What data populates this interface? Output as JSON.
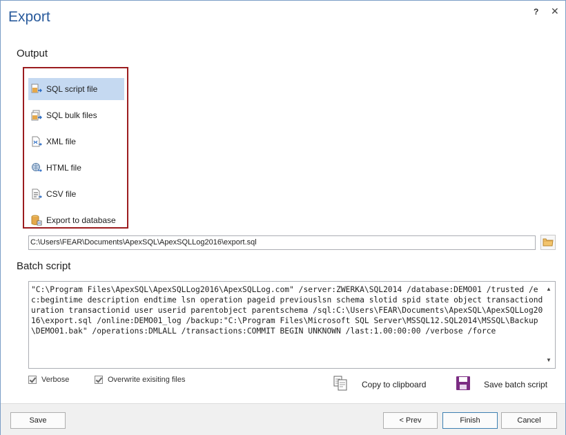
{
  "window": {
    "title": "Export",
    "help_label": "?",
    "close_label": "✕"
  },
  "output": {
    "section_label": "Output",
    "items": [
      {
        "label": "SQL script file",
        "icon": "sql-script-file-icon",
        "selected": true
      },
      {
        "label": "SQL bulk files",
        "icon": "sql-bulk-files-icon",
        "selected": false
      },
      {
        "label": "XML file",
        "icon": "xml-file-icon",
        "selected": false
      },
      {
        "label": "HTML file",
        "icon": "html-file-icon",
        "selected": false
      },
      {
        "label": "CSV file",
        "icon": "csv-file-icon",
        "selected": false
      },
      {
        "label": "Export to database",
        "icon": "export-to-database-icon",
        "selected": false
      }
    ],
    "path_value": "C:\\Users\\FEAR\\Documents\\ApexSQL\\ApexSQLLog2016\\export.sql"
  },
  "batch": {
    "section_label": "Batch script",
    "script_text": "\"C:\\Program Files\\ApexSQL\\ApexSQLLog2016\\ApexSQLLog.com\" /server:ZWERKA\\SQL2014 /database:DEMO01 /trusted /ec:begintime description endtime lsn operation pageid previouslsn schema slotid spid state object transactionduration transactionid user userid parentobject parentschema /sql:C:\\Users\\FEAR\\Documents\\ApexSQL\\ApexSQLLog2016\\export.sql /online:DEMO01_log /backup:\"C:\\Program Files\\Microsoft SQL Server\\MSSQL12.SQL2014\\MSSQL\\Backup\\DEMO01.bak\" /operations:DMLALL /transactions:COMMIT BEGIN UNKNOWN /last:1.00:00:00 /verbose /force",
    "verbose_label": "Verbose",
    "overwrite_label": "Overwrite exisiting files",
    "copy_label": "Copy to clipboard",
    "save_label": "Save batch script"
  },
  "footer": {
    "save": "Save",
    "prev": "< Prev",
    "finish": "Finish",
    "cancel": "Cancel"
  },
  "colors": {
    "title": "#2a5b9c",
    "highlight_border": "#9b1b1e",
    "selected_bg": "#c5d9f1",
    "save_icon": "#7b2c83"
  }
}
